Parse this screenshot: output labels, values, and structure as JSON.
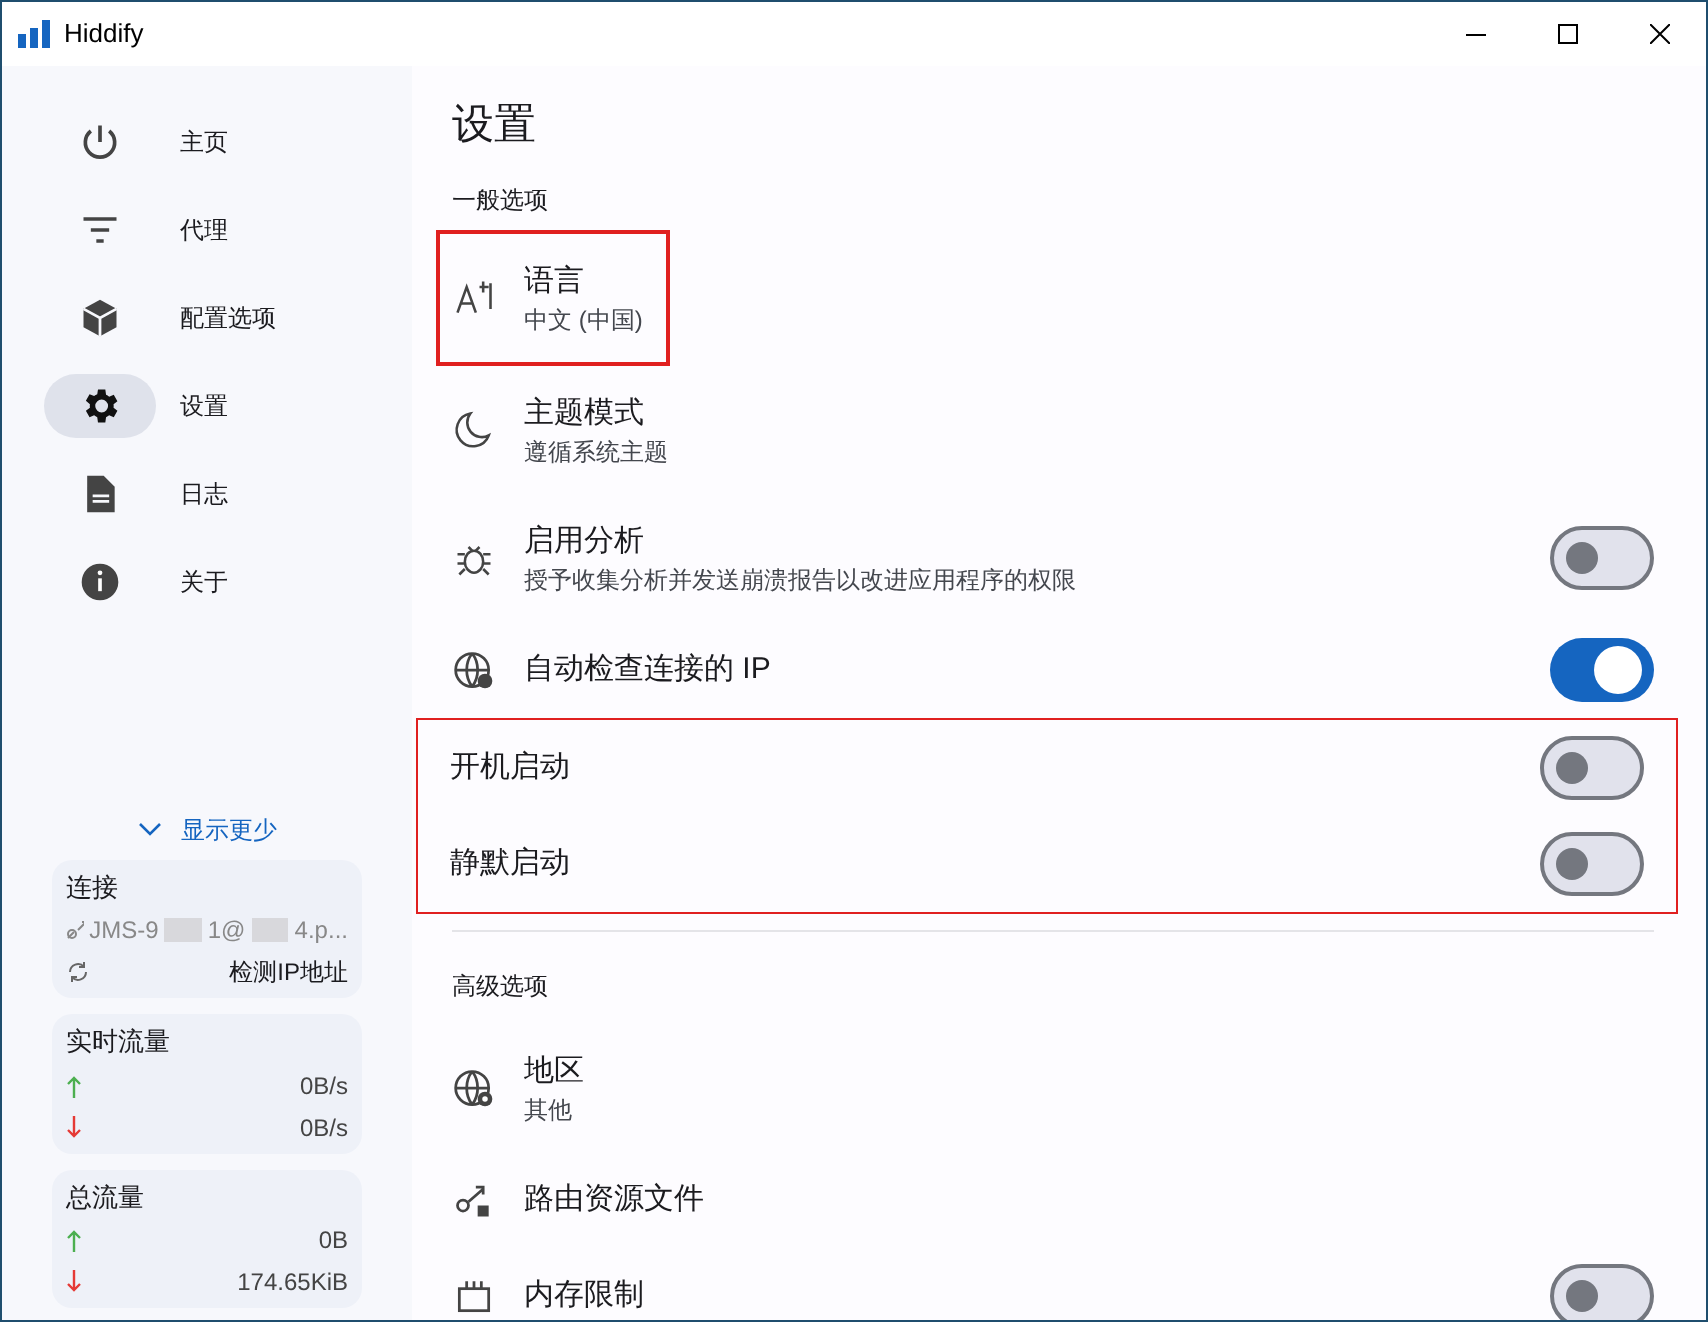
{
  "window": {
    "title": "Hiddify"
  },
  "nav": [
    {
      "label": "主页",
      "selected": false
    },
    {
      "label": "代理",
      "selected": false
    },
    {
      "label": "配置选项",
      "selected": false
    },
    {
      "label": "设置",
      "selected": true
    },
    {
      "label": "日志",
      "selected": false
    },
    {
      "label": "关于",
      "selected": false
    }
  ],
  "show_less": "显示更少",
  "connection": {
    "title": "连接",
    "parts": [
      "JMS-9",
      "1@",
      "4.p..."
    ],
    "action": "检测IP地址"
  },
  "realtime": {
    "title": "实时流量",
    "up": "0B/s",
    "down": "0B/s"
  },
  "total": {
    "title": "总流量",
    "up": "0B",
    "down": "174.65KiB"
  },
  "page_title": "设置",
  "sections": [
    {
      "title": "一般选项",
      "items": [
        {
          "kind": "value",
          "label": "语言",
          "value": "中文 (中国)",
          "highlighted": true
        },
        {
          "kind": "value",
          "label": "主题模式",
          "value": "遵循系统主题",
          "highlighted": false
        },
        {
          "kind": "toggle",
          "label": "启用分析",
          "value": "授予收集分析并发送崩溃报告以改进应用程序的权限",
          "on": false,
          "highlighted": false
        },
        {
          "kind": "toggle",
          "label": "自动检查连接的 IP",
          "on": true,
          "highlighted": false
        },
        {
          "kind": "toggle",
          "label": "开机启动",
          "on": false,
          "highlighted": true
        },
        {
          "kind": "toggle",
          "label": "静默启动",
          "on": false,
          "highlighted": true
        }
      ]
    },
    {
      "title": "高级选项",
      "items": [
        {
          "kind": "value",
          "label": "地区",
          "value": "其他",
          "highlighted": false
        },
        {
          "kind": "value",
          "label": "路由资源文件",
          "highlighted": false
        },
        {
          "kind": "toggle",
          "label": "内存限制",
          "on": false,
          "highlighted": false
        }
      ]
    }
  ]
}
